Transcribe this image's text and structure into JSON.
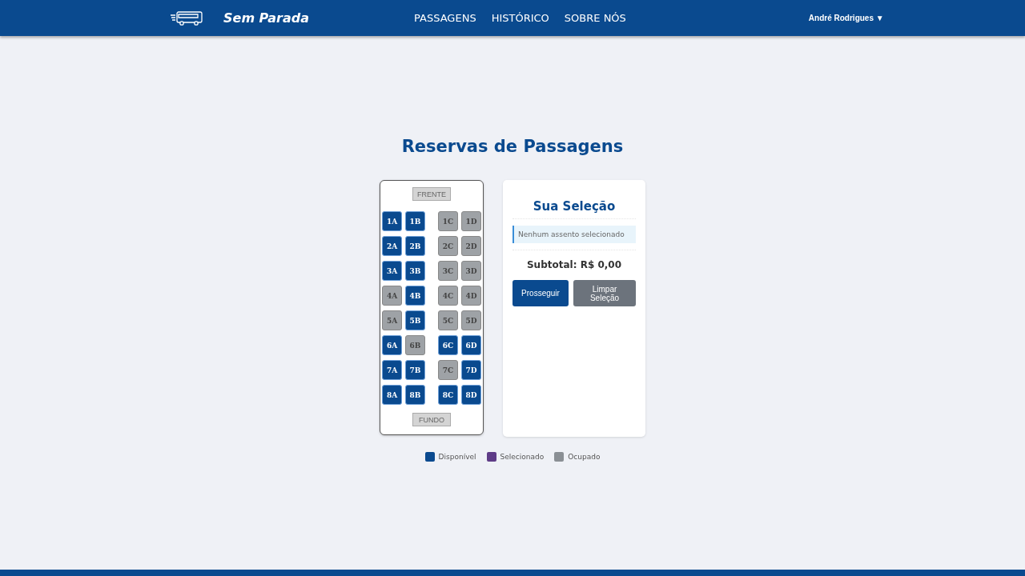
{
  "header": {
    "brand": "Sem Parada",
    "nav": [
      "PASSAGENS",
      "HISTÓRICO",
      "SOBRE NÓS"
    ],
    "user": "André Rodrigues ▼"
  },
  "title": "Reservas de Passagens",
  "bus": {
    "front": "FRENTE",
    "back": "FUNDO",
    "rows": [
      {
        "seats": [
          {
            "label": "1A",
            "occupied": false
          },
          {
            "label": "1B",
            "occupied": false
          },
          {
            "label": "1C",
            "occupied": true
          },
          {
            "label": "1D",
            "occupied": true
          }
        ]
      },
      {
        "seats": [
          {
            "label": "2A",
            "occupied": false
          },
          {
            "label": "2B",
            "occupied": false
          },
          {
            "label": "2C",
            "occupied": true
          },
          {
            "label": "2D",
            "occupied": true
          }
        ]
      },
      {
        "seats": [
          {
            "label": "3A",
            "occupied": false
          },
          {
            "label": "3B",
            "occupied": false
          },
          {
            "label": "3C",
            "occupied": true
          },
          {
            "label": "3D",
            "occupied": true
          }
        ]
      },
      {
        "seats": [
          {
            "label": "4A",
            "occupied": true
          },
          {
            "label": "4B",
            "occupied": false
          },
          {
            "label": "4C",
            "occupied": true
          },
          {
            "label": "4D",
            "occupied": true
          }
        ]
      },
      {
        "seats": [
          {
            "label": "5A",
            "occupied": true
          },
          {
            "label": "5B",
            "occupied": false
          },
          {
            "label": "5C",
            "occupied": true
          },
          {
            "label": "5D",
            "occupied": true
          }
        ]
      },
      {
        "seats": [
          {
            "label": "6A",
            "occupied": false
          },
          {
            "label": "6B",
            "occupied": true
          },
          {
            "label": "6C",
            "occupied": false
          },
          {
            "label": "6D",
            "occupied": false
          }
        ]
      },
      {
        "seats": [
          {
            "label": "7A",
            "occupied": false
          },
          {
            "label": "7B",
            "occupied": false
          },
          {
            "label": "7C",
            "occupied": true
          },
          {
            "label": "7D",
            "occupied": false
          }
        ]
      },
      {
        "seats": [
          {
            "label": "8A",
            "occupied": false
          },
          {
            "label": "8B",
            "occupied": false
          },
          {
            "label": "8C",
            "occupied": false
          },
          {
            "label": "8D",
            "occupied": false
          }
        ]
      }
    ]
  },
  "selection": {
    "title": "Sua Seleção",
    "empty_message": "Nenhum assento selecionado",
    "subtotal": "Subtotal: R$ 0,00",
    "buttons": [
      {
        "label": "Prosseguir",
        "kind": "primary"
      },
      {
        "label": "Limpar Seleção",
        "kind": "secondary"
      }
    ]
  },
  "legend": [
    {
      "label": "Disponível",
      "color": "#0a4a8f"
    },
    {
      "label": "Selecionado",
      "color": "#5e3c87"
    },
    {
      "label": "Ocupado",
      "color": "#8a8f94"
    }
  ]
}
